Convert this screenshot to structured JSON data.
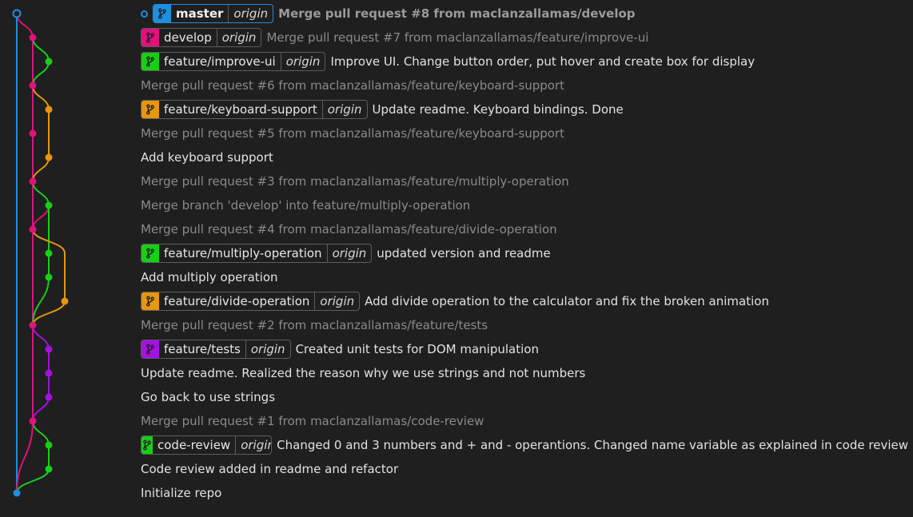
{
  "colors": {
    "blue": "#1e8fde",
    "magenta": "#e0127c",
    "green": "#17cf17",
    "orange": "#e6960f",
    "purple": "#a412e0",
    "background": "#1f1f1f"
  },
  "icons": {
    "branch": "git-branch-icon",
    "head": "head-commit-icon"
  },
  "commits": [
    {
      "message": "Merge pull request #8 from maclanzallamas/develop",
      "style": "bold",
      "branch": {
        "name": "master",
        "remote": "origin",
        "color": "#1e8fde",
        "current": true
      }
    },
    {
      "message": "Merge pull request #7 from maclanzallamas/feature/improve-ui",
      "style": "dim",
      "branch": {
        "name": "develop",
        "remote": "origin",
        "color": "#e0127c"
      }
    },
    {
      "message": "Improve UI. Change button order, put hover and create box for display",
      "style": "normal",
      "branch": {
        "name": "feature/improve-ui",
        "remote": "origin",
        "color": "#17cf17"
      }
    },
    {
      "message": "Merge pull request #6 from maclanzallamas/feature/keyboard-support",
      "style": "dim"
    },
    {
      "message": "Update readme. Keyboard bindings. Done",
      "style": "normal",
      "branch": {
        "name": "feature/keyboard-support",
        "remote": "origin",
        "color": "#e6960f"
      }
    },
    {
      "message": "Merge pull request #5 from maclanzallamas/feature/keyboard-support",
      "style": "dim"
    },
    {
      "message": "Add keyboard support",
      "style": "normal"
    },
    {
      "message": "Merge pull request #3 from maclanzallamas/feature/multiply-operation",
      "style": "dim"
    },
    {
      "message": "Merge branch 'develop' into feature/multiply-operation",
      "style": "dim"
    },
    {
      "message": "Merge pull request #4 from maclanzallamas/feature/divide-operation",
      "style": "dim"
    },
    {
      "message": "updated version and readme",
      "style": "normal",
      "branch": {
        "name": "feature/multiply-operation",
        "remote": "origin",
        "color": "#17cf17"
      }
    },
    {
      "message": "Add multiply operation",
      "style": "normal"
    },
    {
      "message": "Add divide operation to the calculator and fix the broken animation",
      "style": "normal",
      "branch": {
        "name": "feature/divide-operation",
        "remote": "origin",
        "color": "#e6960f"
      }
    },
    {
      "message": "Merge pull request #2 from maclanzallamas/feature/tests",
      "style": "dim"
    },
    {
      "message": "Created unit tests for DOM manipulation",
      "style": "normal",
      "branch": {
        "name": "feature/tests",
        "remote": "origin",
        "color": "#a412e0"
      }
    },
    {
      "message": "Update readme. Realized the reason why we use strings and not numbers",
      "style": "normal"
    },
    {
      "message": "Go back to use strings",
      "style": "normal"
    },
    {
      "message": "Merge pull request #1 from maclanzallamas/code-review",
      "style": "dim"
    },
    {
      "message": "Changed 0 and 3 numbers and + and - operantions. Changed name variable as explained in code review",
      "style": "normal",
      "branch": {
        "name": "code-review",
        "remote": "origin",
        "color": "#17cf17"
      }
    },
    {
      "message": "Code review added in readme and refactor",
      "style": "normal"
    },
    {
      "message": "Initialize repo",
      "style": "normal"
    }
  ]
}
